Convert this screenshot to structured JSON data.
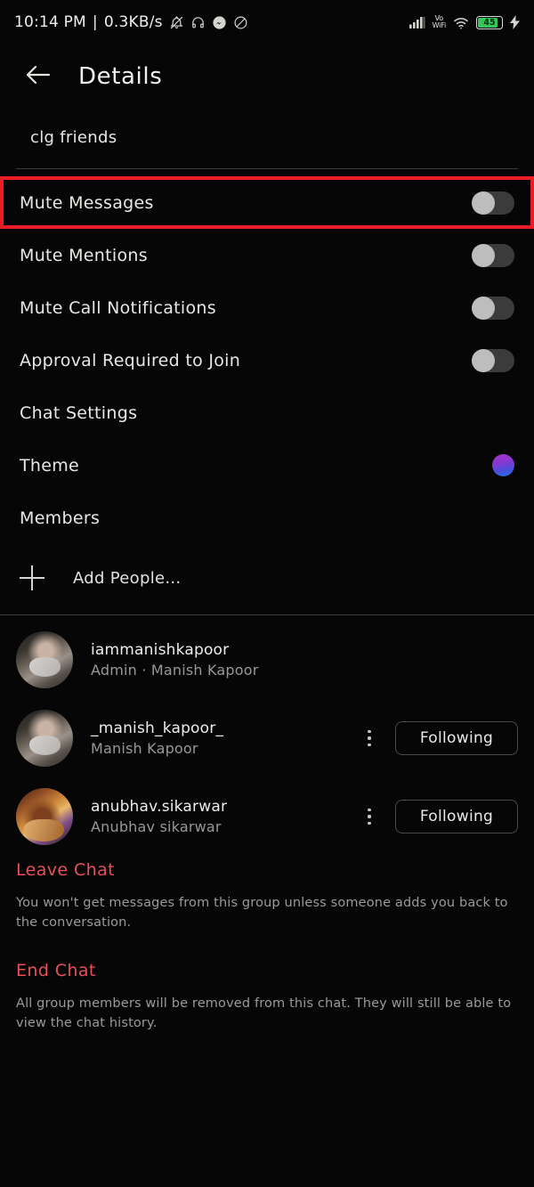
{
  "status_bar": {
    "time": "10:14 PM",
    "separator": "|",
    "network_speed": "0.3KB/s",
    "left_icons": [
      "bell-muted-icon",
      "headphones-icon",
      "messenger-icon",
      "do-not-disturb-icon"
    ],
    "signal_label": "signal-bars-icon",
    "vowifi_line1": "Vo",
    "vowifi_line2": "WiFi",
    "wifi_label": "wifi-icon",
    "battery_percent": "45",
    "charging": "charging-bolt-icon"
  },
  "header": {
    "back_label": "back-arrow-icon",
    "title": "Details"
  },
  "group": {
    "name": "clg friends"
  },
  "settings": {
    "rows": [
      {
        "label": "Mute Messages",
        "control": "toggle",
        "value": "off",
        "highlighted": true
      },
      {
        "label": "Mute Mentions",
        "control": "toggle",
        "value": "off",
        "highlighted": false
      },
      {
        "label": "Mute Call Notifications",
        "control": "toggle",
        "value": "off",
        "highlighted": false
      },
      {
        "label": "Approval Required to Join",
        "control": "toggle",
        "value": "off",
        "highlighted": false
      },
      {
        "label": "Chat Settings",
        "control": "none",
        "value": "",
        "highlighted": false
      },
      {
        "label": "Theme",
        "control": "swatch",
        "value": "purple-blue-gradient",
        "highlighted": false
      },
      {
        "label": "Members",
        "control": "none",
        "value": "",
        "highlighted": false
      }
    ]
  },
  "add_people": {
    "icon": "plus-icon",
    "label": "Add People..."
  },
  "members": [
    {
      "username": "iammanishkapoor",
      "subtitle": "Admin · Manish Kapoor",
      "action_label": "",
      "has_action": false,
      "avatar": "masked-person-photo"
    },
    {
      "username": "_manish_kapoor_",
      "subtitle": "Manish Kapoor",
      "action_label": "Following",
      "has_action": true,
      "avatar": "masked-person-photo"
    },
    {
      "username": "anubhav.sikarwar",
      "subtitle": "Anubhav sikarwar",
      "action_label": "Following",
      "has_action": true,
      "avatar": "food-table-photo"
    }
  ],
  "danger": {
    "leave": {
      "title": "Leave Chat",
      "description": "You won't get messages from this group unless someone adds you back to the conversation."
    },
    "end": {
      "title": "End Chat",
      "description": "All group members will be removed from this chat. They will still be able to view the chat history."
    }
  },
  "colors": {
    "background": "#060606",
    "text_primary": "#e9e7e4",
    "text_secondary": "#9a9894",
    "danger": "#e8505a",
    "highlight_box": "#ee1c25",
    "toggle_track": "#3b3b3b",
    "toggle_knob": "#bdbdbd",
    "battery_green": "#35c759"
  }
}
